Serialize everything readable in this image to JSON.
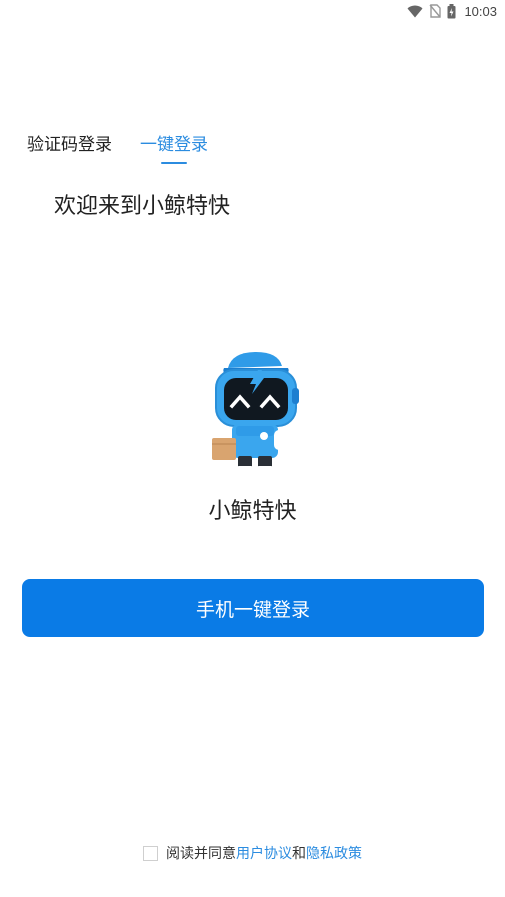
{
  "status_bar": {
    "time": "10:03",
    "icons": [
      "wifi-icon",
      "no-sim-icon",
      "battery-charging-icon"
    ]
  },
  "tabs": [
    {
      "label": "验证码登录",
      "active": false
    },
    {
      "label": "一键登录",
      "active": true
    }
  ],
  "welcome_text": "欢迎来到小鲸特快",
  "app_name": "小鲸特快",
  "login_button_label": "手机一键登录",
  "agreement": {
    "prefix": "阅读并同意",
    "user_agreement": "用户协议",
    "and": "和",
    "privacy_policy": "隐私政策",
    "checked": false
  },
  "colors": {
    "accent": "#2b8ce0",
    "button": "#0a7be6"
  }
}
